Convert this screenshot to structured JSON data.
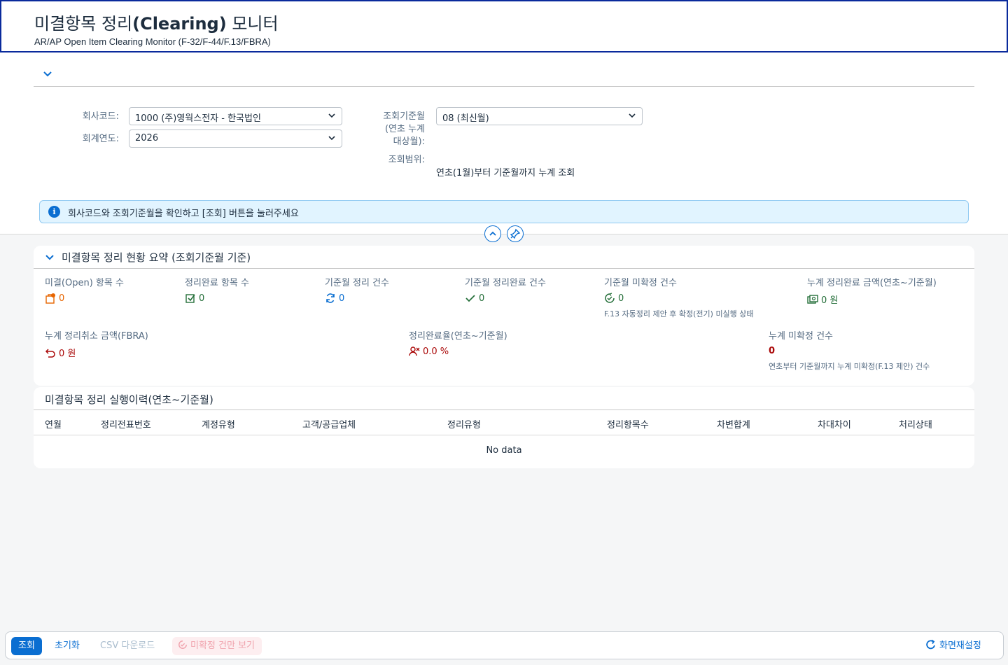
{
  "header": {
    "title_prefix": "미결항목 정리",
    "title_bold": "(Clearing)",
    "title_suffix": " 모니터",
    "subtitle": "AR/AP Open Item Clearing Monitor (F-32/F-44/F.13/FBRA)"
  },
  "filters": {
    "company_code_label": "회사코드:",
    "company_code_value": "1000 (주)영웍스전자 - 한국법인",
    "fiscal_year_label": "회계연도:",
    "fiscal_year_value": "2026",
    "period_label_line1": "조회기준월",
    "period_label_line2": "(연초 누계",
    "period_label_line3": "대상월):",
    "period_value": "08 (최신월)",
    "range_label": "조회범위:",
    "range_value": "연초(1월)부터 기준월까지 누계 조회"
  },
  "info_strip": {
    "icon": "info-icon",
    "text": "회사코드와 조회기준월을 확인하고 [조회] 버튼을 눌러주세요"
  },
  "summary": {
    "title": "미결항목 정리 현황 요약 (조회기준월 기준)",
    "kpis": [
      {
        "label": "미결(Open) 항목 수",
        "value": "0",
        "icon": "open-items-icon",
        "color": "#e76500"
      },
      {
        "label": "정리완료 항목 수",
        "value": "0",
        "icon": "checkbox-check-icon",
        "color": "#256f3a"
      },
      {
        "label": "기준월 정리 건수",
        "value": "0",
        "icon": "refresh-icon",
        "color": "#0a6ed1"
      },
      {
        "label": "기준월 정리완료 건수",
        "value": "0",
        "icon": "check-icon",
        "color": "#256f3a"
      },
      {
        "label": "기준월 미확정 건수",
        "value": "0",
        "icon": "pending-icon",
        "color": "#256f3a",
        "note": "F.13 자동정리 제안 후 확정(전기) 미실행 상태"
      },
      {
        "label": "누계 정리완료 금액(연초~기준월)",
        "value": "0 원",
        "icon": "money-bills-icon",
        "color": "#256f3a"
      },
      {
        "label": "누계 정리취소 금액(FBRA)",
        "value": "0 원",
        "icon": "undo-icon",
        "color": "#aa0808"
      },
      {
        "label": "정리완료율(연초~기준월)",
        "value": "0.0 %",
        "icon": "user-rate-icon",
        "color": "#aa0808"
      },
      {
        "label": "누계 미확정 건수",
        "value": "0",
        "icon": "",
        "color": "#aa0808",
        "note": "연초부터 기준월까지 누계 미확정(F.13 제안) 건수"
      }
    ]
  },
  "history": {
    "title": "미결항목 정리 실행이력(연초~기준월)",
    "columns": [
      "연월",
      "정리전표번호",
      "계정유형",
      "고객/공급업체",
      "정리유형",
      "정리항목수",
      "차변합계",
      "차대차이",
      "처리상태"
    ],
    "empty_text": "No data"
  },
  "footer": {
    "search_button": "조회",
    "reset_button": "초기화",
    "csv_button": "CSV 다운로드",
    "pending_only_button": "미확정 건만 보기",
    "screen_reset_button": "화면재설정"
  }
}
